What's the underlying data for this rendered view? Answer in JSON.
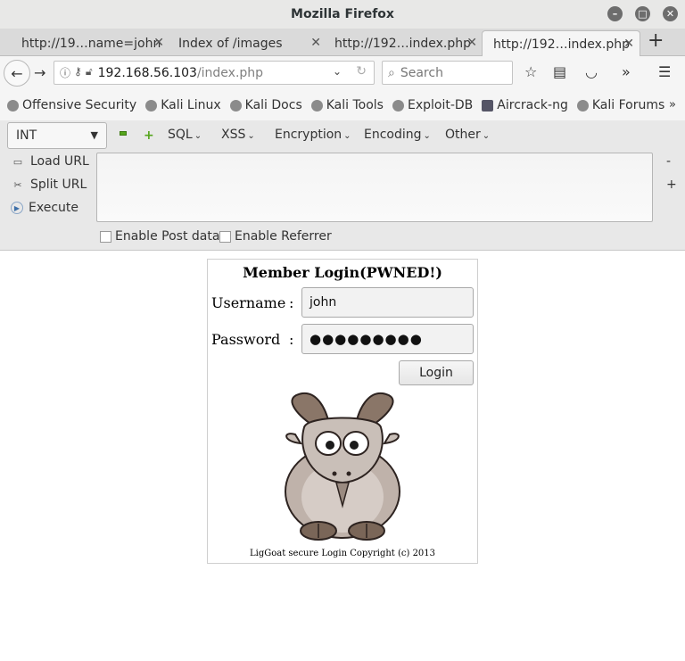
{
  "window": {
    "title": "Mozilla Firefox"
  },
  "tabs": [
    {
      "label": "http://19…name=john"
    },
    {
      "label": "Index of /images"
    },
    {
      "label": "http://192…index.php"
    },
    {
      "label": "http://192…index.php"
    }
  ],
  "nav": {
    "url_host": "192.168.56.103",
    "url_path": "/index.php",
    "search_placeholder": "Search"
  },
  "bookmarks": [
    {
      "label": "Offensive Security"
    },
    {
      "label": "Kali Linux"
    },
    {
      "label": "Kali Docs"
    },
    {
      "label": "Kali Tools"
    },
    {
      "label": "Exploit-DB"
    },
    {
      "label": "Aircrack-ng"
    },
    {
      "label": "Kali Forums"
    }
  ],
  "hackbar": {
    "select_value": "INT",
    "menus": [
      "SQL",
      "XSS",
      "Encryption",
      "Encoding",
      "Other"
    ],
    "actions": {
      "load": "Load URL",
      "split": "Split URL",
      "execute": "Execute"
    },
    "checks": {
      "post": "Enable Post data",
      "referrer": "Enable Referrer"
    },
    "side": {
      "minus": "-",
      "plus": "+"
    }
  },
  "login": {
    "heading": "Member Login(PWNED!)",
    "username_label": "Username",
    "password_label": "Password",
    "colon": ":",
    "username_value": "john",
    "password_value": "●●●●●●●●●",
    "button": "Login",
    "footer": "LigGoat secure Login Copyright (c) 2013"
  },
  "colors": {
    "accent_green": "#55a51c"
  }
}
